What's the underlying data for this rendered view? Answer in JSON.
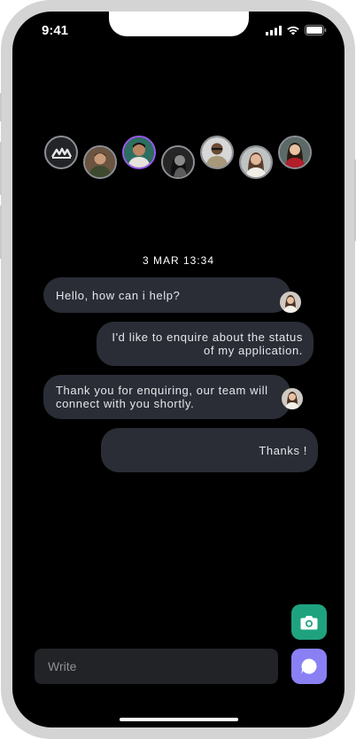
{
  "status_bar": {
    "time": "9:41"
  },
  "avatars": [
    {
      "name": "brand-logo-avatar",
      "active": false
    },
    {
      "name": "avatar-2",
      "active": false
    },
    {
      "name": "avatar-3",
      "active": true
    },
    {
      "name": "avatar-4",
      "active": false
    },
    {
      "name": "avatar-5",
      "active": false
    },
    {
      "name": "avatar-6",
      "active": false
    },
    {
      "name": "avatar-7",
      "active": false
    }
  ],
  "chat": {
    "date": "3 MAR 13:34",
    "messages": [
      {
        "direction": "in",
        "text": "Hello, how can i help?"
      },
      {
        "direction": "out",
        "text": "I'd like to enquire about the status of my application."
      },
      {
        "direction": "in",
        "text": "Thank you for enquiring, our team will connect with you shortly."
      },
      {
        "direction": "out",
        "text": "Thanks !"
      }
    ]
  },
  "composer": {
    "placeholder": "Write"
  },
  "actions": {
    "camera_icon": "camera-icon",
    "chat_icon": "chat-bubble-icon",
    "camera_color": "#1fa37f",
    "chat_color": "#8a80f4"
  }
}
